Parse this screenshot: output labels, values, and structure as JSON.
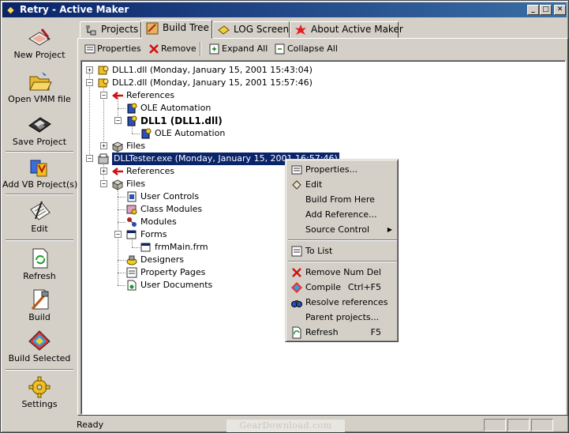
{
  "window": {
    "title": "Retry - Active Maker"
  },
  "side_toolbar": [
    {
      "label": "New Project",
      "icon": "new-project-icon"
    },
    {
      "label": "Open VMM file",
      "icon": "open-folder-icon"
    },
    {
      "label": "Save Project",
      "icon": "save-disk-icon"
    },
    {
      "label": "Add VB Project(s)",
      "icon": "add-vb-project-icon"
    },
    {
      "label": "Edit",
      "icon": "edit-clipboard-icon"
    },
    {
      "label": "Refresh",
      "icon": "refresh-icon"
    },
    {
      "label": "Build",
      "icon": "build-tools-icon"
    },
    {
      "label": "Build Selected",
      "icon": "build-selected-icon"
    },
    {
      "label": "Settings",
      "icon": "settings-gear-icon"
    }
  ],
  "tabs": [
    {
      "label": "Projects",
      "active": false
    },
    {
      "label": "Build Tree",
      "active": true
    },
    {
      "label": "LOG Screen",
      "active": false
    },
    {
      "label": "About Active Maker",
      "active": false
    }
  ],
  "toolbar": {
    "properties": "Properties",
    "remove": "Remove",
    "expand_all": "Expand All",
    "collapse_all": "Collapse All"
  },
  "tree": [
    {
      "text": "DLL1.dll (Monday, January 15, 2001 15:43:04)"
    },
    {
      "text": "DLL2.dll (Monday, January 15, 2001 15:57:46)"
    },
    {
      "text": "References"
    },
    {
      "text": "OLE Automation"
    },
    {
      "text": "DLL1 (DLL1.dll)"
    },
    {
      "text": "OLE Automation"
    },
    {
      "text": "Files"
    },
    {
      "text": "DLLTester.exe (Monday, January 15, 2001 16:57:46)"
    },
    {
      "text": "References"
    },
    {
      "text": "Files"
    },
    {
      "text": "User Controls"
    },
    {
      "text": "Class Modules"
    },
    {
      "text": "Modules"
    },
    {
      "text": "Forms"
    },
    {
      "text": "frmMain.frm"
    },
    {
      "text": "Designers"
    },
    {
      "text": "Property Pages"
    },
    {
      "text": "User Documents"
    }
  ],
  "context_menu": [
    {
      "label": "Properties...",
      "shortcut": ""
    },
    {
      "label": "Edit",
      "shortcut": ""
    },
    {
      "label": "Build From Here",
      "shortcut": ""
    },
    {
      "label": "Add Reference...",
      "shortcut": ""
    },
    {
      "label": "Source Control",
      "shortcut": ""
    },
    {
      "label": "To List",
      "shortcut": ""
    },
    {
      "label": "Remove",
      "shortcut": "Num Del"
    },
    {
      "label": "Compile",
      "shortcut": "Ctrl+F5"
    },
    {
      "label": "Resolve references",
      "shortcut": ""
    },
    {
      "label": "Parent projects...",
      "shortcut": ""
    },
    {
      "label": "Refresh",
      "shortcut": "F5"
    }
  ],
  "status": {
    "text": "Ready"
  },
  "watermark": "GearDownload.com"
}
